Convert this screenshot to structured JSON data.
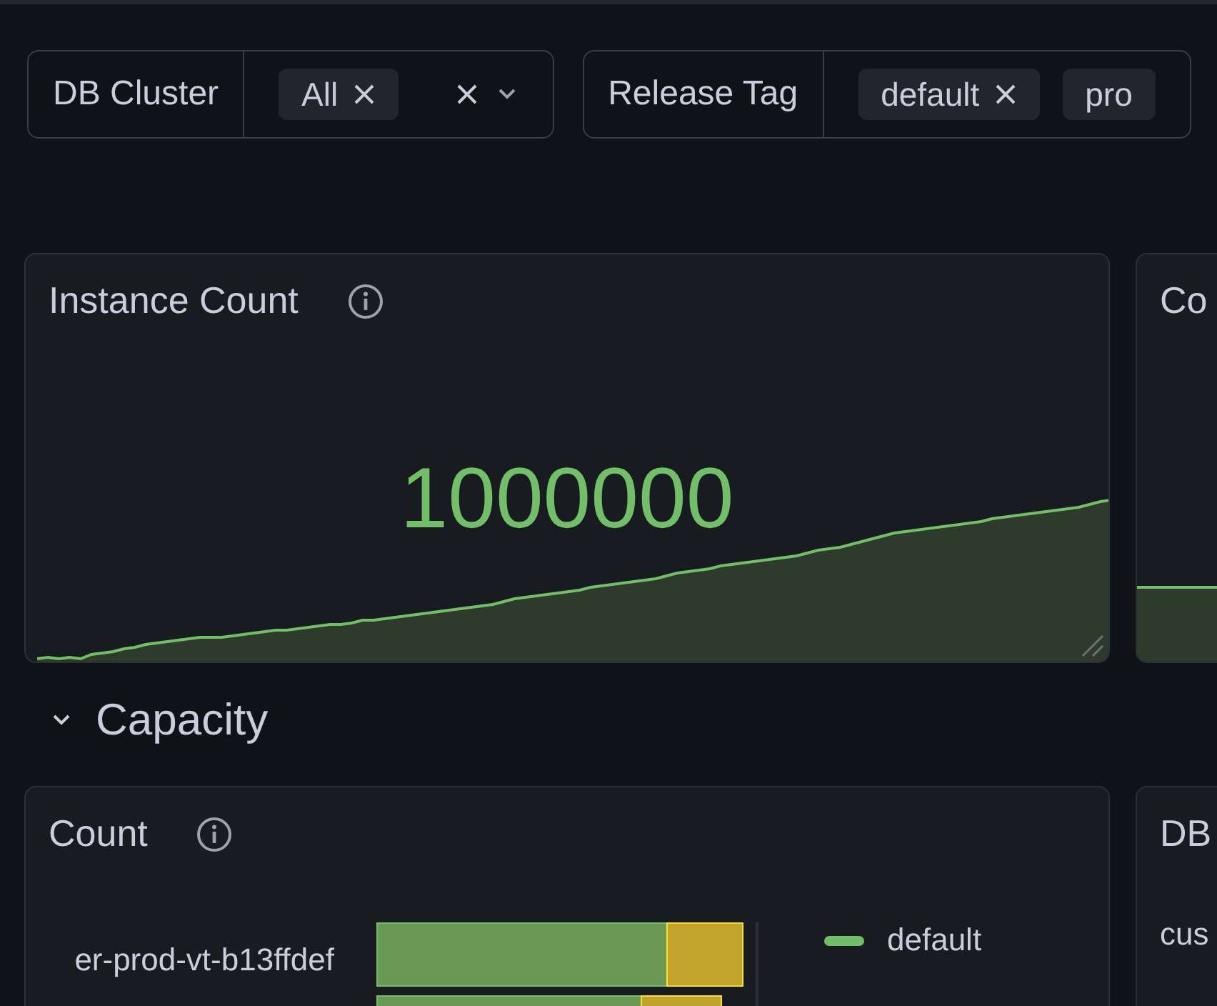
{
  "filters": [
    {
      "label": "DB Cluster",
      "chips": [
        {
          "text": "All",
          "removable": true
        }
      ],
      "clear_button": true
    },
    {
      "label": "Release Tag",
      "chips": [
        {
          "text": "default",
          "removable": true
        },
        {
          "text": "pro",
          "removable": false
        }
      ],
      "clear_button": false
    }
  ],
  "stat_panels": [
    {
      "title": "Instance Count",
      "info": true,
      "value": "1000000"
    },
    {
      "title": "Co"
    }
  ],
  "section": {
    "title": "Capacity",
    "expanded": true
  },
  "bottom_panels": [
    {
      "title": "Count",
      "info": true,
      "rows": [
        "er-prod-vt-b13ffdef"
      ],
      "legend": [
        {
          "name": "default",
          "color": "#73bf69"
        }
      ]
    },
    {
      "title": "DB",
      "rows": [
        "cus"
      ]
    }
  ]
}
